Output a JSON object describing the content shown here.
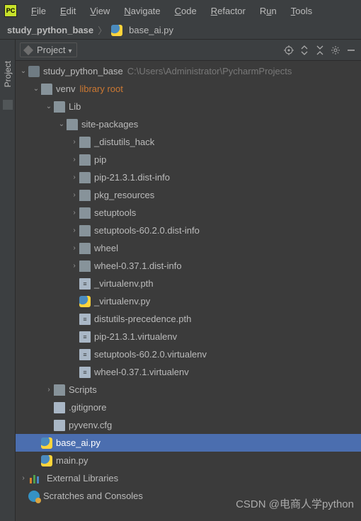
{
  "menubar": {
    "items": [
      {
        "mne": "F",
        "rest": "ile"
      },
      {
        "mne": "E",
        "rest": "dit"
      },
      {
        "mne": "V",
        "rest": "iew"
      },
      {
        "mne": "N",
        "rest": "avigate"
      },
      {
        "mne": "C",
        "rest": "ode"
      },
      {
        "mne": "R",
        "rest": "efactor"
      },
      {
        "mne": "R",
        "rest": "u",
        "rest2": "n"
      },
      {
        "mne": "T",
        "rest": "ools"
      }
    ],
    "run_label_pre": "R",
    "run_label_mne": "u",
    "run_label_post": "n"
  },
  "breadcrumb": {
    "project": "study_python_base",
    "file": "base_ai.py"
  },
  "project_panel": {
    "title": "Project"
  },
  "sidebar": {
    "tab_label": "Project"
  },
  "tree": {
    "root": "study_python_base",
    "root_hint": "C:\\Users\\Administrator\\PycharmProjects",
    "venv": "venv",
    "venv_hint": "library root",
    "lib": "Lib",
    "site_packages": "site-packages",
    "folders_collapsed": [
      "_distutils_hack",
      "pip",
      "pip-21.3.1.dist-info",
      "pkg_resources",
      "setuptools",
      "setuptools-60.2.0.dist-info",
      "wheel",
      "wheel-0.37.1.dist-info"
    ],
    "files_sp": [
      {
        "name": "_virtualenv.pth",
        "icon": "file"
      },
      {
        "name": "_virtualenv.py",
        "icon": "py"
      },
      {
        "name": "distutils-precedence.pth",
        "icon": "file"
      },
      {
        "name": "pip-21.3.1.virtualenv",
        "icon": "file"
      },
      {
        "name": "setuptools-60.2.0.virtualenv",
        "icon": "file"
      },
      {
        "name": "wheel-0.37.1.virtualenv",
        "icon": "file"
      }
    ],
    "scripts": "Scripts",
    "gitignore": ".gitignore",
    "pyvenv": "pyvenv.cfg",
    "base_ai": "base_ai.py",
    "main_py": "main.py",
    "ext_lib": "External Libraries",
    "scratch": "Scratches and Consoles"
  },
  "watermark": "CSDN @电商人学python"
}
